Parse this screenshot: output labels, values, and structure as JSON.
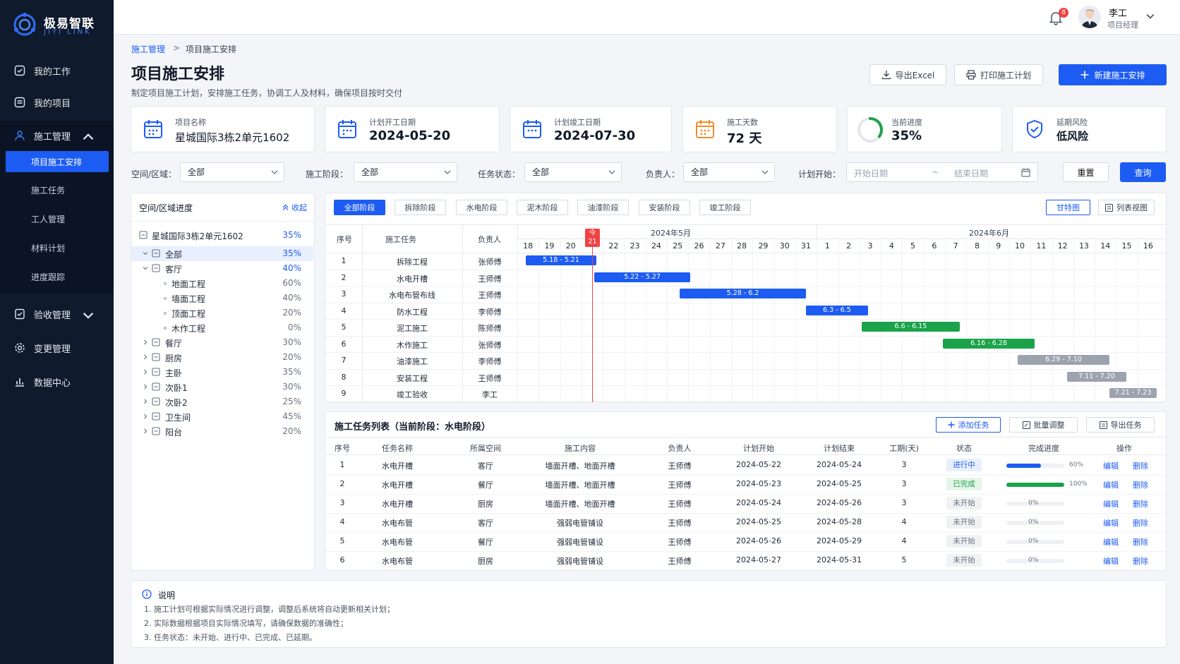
{
  "brand": {
    "name_cn": "极易智联",
    "name_en": "JIYI LINK"
  },
  "sidebar": {
    "items": [
      {
        "label": "我的工作",
        "icon": "work-icon"
      },
      {
        "label": "我的项目",
        "icon": "project-icon"
      },
      {
        "label": "施工管理",
        "icon": "user-icon",
        "expanded": true
      },
      {
        "label": "验收管理",
        "icon": "acceptance-icon"
      },
      {
        "label": "变更管理",
        "icon": "gear-icon"
      },
      {
        "label": "数据中心",
        "icon": "chart-icon"
      }
    ],
    "sub_items": [
      "项目施工安排",
      "施工任务",
      "工人管理",
      "材料计划",
      "进度跟踪"
    ],
    "active_sub": "项目施工安排"
  },
  "topbar": {
    "notification_count": "8",
    "user_name": "李工",
    "user_role": "项目经理"
  },
  "breadcrumb": {
    "parent": "施工管理",
    "sep": ">",
    "current": "项目施工安排"
  },
  "page": {
    "title": "项目施工安排",
    "description": "制定项目施工计划，安排施工任务，协调工人及材料，确保项目按时交付"
  },
  "actions": {
    "export": "导出Excel",
    "print": "打印施工计划",
    "new": "新建施工安排"
  },
  "summary": {
    "project_label": "项目名称",
    "project_value": "星城国际3栋2单元1602",
    "start_label": "计划开工日期",
    "start_value": "2024-05-20",
    "end_label": "计划竣工日期",
    "end_value": "2024-07-30",
    "days_label": "施工天数",
    "days_value": "72 天",
    "progress_label": "当前进度",
    "progress_value": "35%",
    "progress_fraction": 0.35,
    "risk_label": "延期风险",
    "risk_value": "低风险"
  },
  "filters": {
    "area_label": "空间/区域：",
    "area_value": "全部",
    "stage_label": "施工阶段：",
    "stage_value": "全部",
    "status_label": "任务状态：",
    "status_value": "全部",
    "owner_label": "负责人：",
    "owner_value": "全部",
    "start_label": "计划开始：",
    "date_from_placeholder": "开始日期",
    "date_sep": "~",
    "date_to_placeholder": "结束日期",
    "reset": "重置",
    "query": "查询"
  },
  "tree": {
    "title": "空间/区域进度",
    "collapse": "收起",
    "root": {
      "name": "星城国际3栋2单元1602",
      "pct": "35%"
    },
    "nodes": [
      {
        "name": "全部",
        "pct": "35%",
        "level": 1,
        "open": true,
        "selected": true
      },
      {
        "name": "客厅",
        "pct": "40%",
        "level": 1,
        "open": true
      },
      {
        "name": "地面工程",
        "pct": "60%",
        "level": 2
      },
      {
        "name": "墙面工程",
        "pct": "40%",
        "level": 2
      },
      {
        "name": "顶面工程",
        "pct": "20%",
        "level": 2
      },
      {
        "name": "木作工程",
        "pct": "0%",
        "level": 2
      },
      {
        "name": "餐厅",
        "pct": "30%",
        "level": 1
      },
      {
        "name": "厨房",
        "pct": "20%",
        "level": 1
      },
      {
        "name": "主卧",
        "pct": "35%",
        "level": 1
      },
      {
        "name": "次卧1",
        "pct": "30%",
        "level": 1
      },
      {
        "name": "次卧2",
        "pct": "25%",
        "level": 1
      },
      {
        "name": "卫生间",
        "pct": "45%",
        "level": 1
      },
      {
        "name": "阳台",
        "pct": "20%",
        "level": 1
      }
    ]
  },
  "stages": [
    "全部阶段",
    "拆除阶段",
    "水电阶段",
    "泥木阶段",
    "油漆阶段",
    "安装阶段",
    "竣工阶段"
  ],
  "views": {
    "gantt": "甘特图",
    "list": "列表视图"
  },
  "gantt": {
    "headers": {
      "no": "序号",
      "task": "施工任务",
      "owner": "负责人"
    },
    "month_may": "2024年5月",
    "month_june": "2024年6月",
    "days": [
      "18",
      "19",
      "20",
      "21",
      "22",
      "23",
      "24",
      "25",
      "26",
      "27",
      "28",
      "29",
      "30",
      "31",
      "1",
      "2",
      "3",
      "4",
      "5",
      "6",
      "7",
      "8",
      "9",
      "10",
      "11",
      "12",
      "13",
      "14",
      "15",
      "16"
    ],
    "today_label": "今",
    "today_day": "21",
    "tasks": [
      {
        "no": "1",
        "name": "拆除工程",
        "owner": "张师傅",
        "bar": "5.18 - 5.21",
        "start": 0,
        "end": 3.3,
        "color": "#1d5cf2"
      },
      {
        "no": "2",
        "name": "水电开槽",
        "owner": "王师傅",
        "bar": "5.22 - 5.27",
        "start": 3.2,
        "end": 7.7,
        "color": "#1d5cf2"
      },
      {
        "no": "3",
        "name": "水电布管布线",
        "owner": "王师傅",
        "bar": "5.28 - 6.2",
        "start": 7.2,
        "end": 13.1,
        "color": "#1d5cf2"
      },
      {
        "no": "4",
        "name": "防水工程",
        "owner": "李师傅",
        "bar": "6.3 - 6.5",
        "start": 13.1,
        "end": 16.0,
        "color": "#1d5cf2"
      },
      {
        "no": "5",
        "name": "泥工施工",
        "owner": "陈师傅",
        "bar": "6.6 - 6.15",
        "start": 15.7,
        "end": 20.3,
        "color": "#1aa34a"
      },
      {
        "no": "6",
        "name": "木作施工",
        "owner": "张师傅",
        "bar": "6.16 - 6.28",
        "start": 19.5,
        "end": 23.8,
        "color": "#1aa34a"
      },
      {
        "no": "7",
        "name": "油漆施工",
        "owner": "李师傅",
        "bar": "6.29 - 7.10",
        "start": 23.0,
        "end": 27.3,
        "color": "#9ca3af"
      },
      {
        "no": "8",
        "name": "安装工程",
        "owner": "王师傅",
        "bar": "7.11 - 7.20",
        "start": 25.3,
        "end": 28.1,
        "color": "#9ca3af"
      },
      {
        "no": "9",
        "name": "竣工验收",
        "owner": "李工",
        "bar": "7.21 - 7.23",
        "start": 27.3,
        "end": 29.5,
        "color": "#9ca3af"
      }
    ]
  },
  "task_table": {
    "title": "施工任务列表（当前阶段：水电阶段）",
    "add": "添加任务",
    "batch": "批量调整",
    "export": "导出任务",
    "headers": [
      "序号",
      "任务名称",
      "所属空间",
      "施工内容",
      "负责人",
      "计划开始",
      "计划结束",
      "工期(天)",
      "状态",
      "完成进度",
      "操作"
    ],
    "edit": "编辑",
    "delete": "删除",
    "rows": [
      {
        "no": "1",
        "name": "水电开槽",
        "space": "客厅",
        "content": "墙面开槽、地面开槽",
        "owner": "王师傅",
        "start": "2024-05-22",
        "end": "2024-05-24",
        "days": "3",
        "status": "进行中",
        "status_kind": "doing",
        "progress": "60%",
        "fraction": 0.6
      },
      {
        "no": "2",
        "name": "水电开槽",
        "space": "餐厅",
        "content": "墙面开槽、地面开槽",
        "owner": "王师傅",
        "start": "2024-05-23",
        "end": "2024-05-25",
        "days": "3",
        "status": "已完成",
        "status_kind": "done",
        "progress": "100%",
        "fraction": 1.0
      },
      {
        "no": "3",
        "name": "水电开槽",
        "space": "厨房",
        "content": "墙面开槽、地面开槽",
        "owner": "王师傅",
        "start": "2024-05-24",
        "end": "2024-05-26",
        "days": "3",
        "status": "未开始",
        "status_kind": "todo",
        "progress": "0%",
        "fraction": 0
      },
      {
        "no": "4",
        "name": "水电布管",
        "space": "客厅",
        "content": "强弱电管铺设",
        "owner": "王师傅",
        "start": "2024-05-25",
        "end": "2024-05-28",
        "days": "4",
        "status": "未开始",
        "status_kind": "todo",
        "progress": "0%",
        "fraction": 0
      },
      {
        "no": "5",
        "name": "水电布管",
        "space": "餐厅",
        "content": "强弱电管铺设",
        "owner": "王师傅",
        "start": "2024-05-26",
        "end": "2024-05-29",
        "days": "4",
        "status": "未开始",
        "status_kind": "todo",
        "progress": "0%",
        "fraction": 0
      },
      {
        "no": "6",
        "name": "水电布管",
        "space": "厨房",
        "content": "强弱电管铺设",
        "owner": "王师傅",
        "start": "2024-05-27",
        "end": "2024-05-31",
        "days": "5",
        "status": "未开始",
        "status_kind": "todo",
        "progress": "0%",
        "fraction": 0
      }
    ]
  },
  "notes": {
    "title": "说明",
    "lines": [
      "1.  施工计划可根据实际情况进行调整，调整后系统将自动更新相关计划；",
      "2.  实际数据根据项目实际情况填写，请确保数据的准确性；",
      "3.  任务状态：未开始、进行中、已完成、已延期。"
    ]
  },
  "colors": {
    "primary": "#1d5cf2",
    "success": "#1aa34a",
    "pending": "#9ca3af",
    "sidebar": "#0f1a2c",
    "today": "#ef4444"
  }
}
